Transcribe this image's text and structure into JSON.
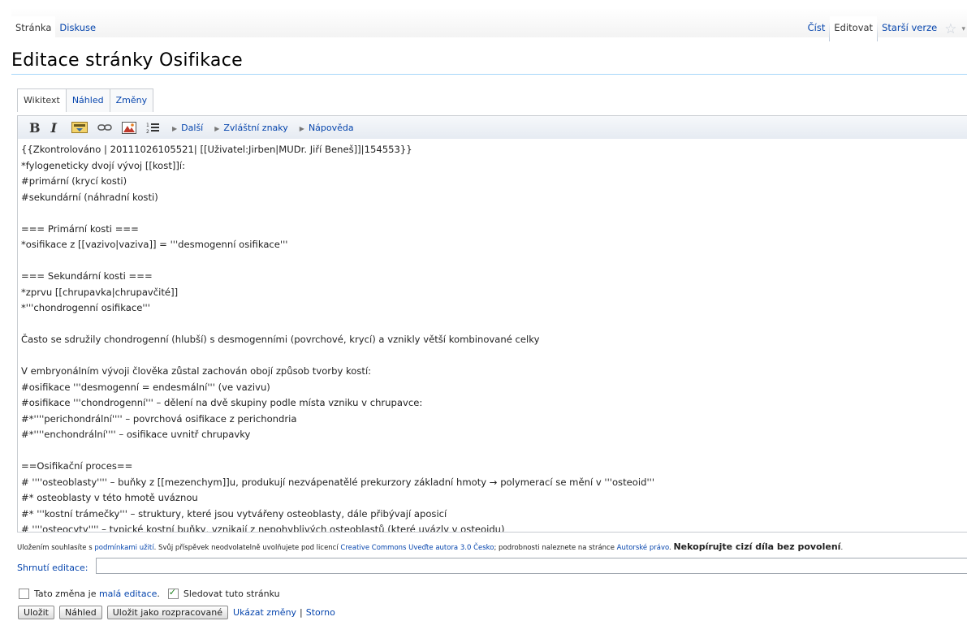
{
  "page_tabs_left": [
    "Stránka",
    "Diskuse"
  ],
  "page_tabs_right": [
    "Číst",
    "Editovat",
    "Starší verze"
  ],
  "title": "Editace stránky Osifikace",
  "editor_tabs": [
    "Wikitext",
    "Náhled",
    "Změny"
  ],
  "toolbar": {
    "bold": "B",
    "italic": "I",
    "more": "Další",
    "special_chars": "Zvláštní znaky",
    "help": "Nápověda"
  },
  "wikitext": "{{Zkontrolováno | 20111026105521| [[Uživatel:Jirben|MUDr. Jiří Beneš]]|154553}}\n*fylogeneticky dvojí vývoj [[kost]]í:\n#primární (krycí kosti)\n#sekundární (náhradní kosti)\n\n=== Primární kosti ===\n*osifikace z [[vazivo|vaziva]] = '''desmogenní osifikace'''\n\n=== Sekundární kosti ===\n*zprvu [[chrupavka|chrupavčité]]\n*'''chondrogenní osifikace'''\n\nČasto se sdružily chondrogenní (hlubší) s desmogenními (povrchové, krycí) a vznikly větší kombinované celky\n\nV embryonálním vývoji člověka zůstal zachován obojí způsob tvorby kostí:\n#osifikace '''desmogenní = endesmální''' (ve vazivu)\n#osifikace '''chondrogenní''' – dělení na dvě skupiny podle místa vzniku v chrupavce:\n#*''''perichondrální'''' – povrchová osifikace z perichondria\n#*''''enchondrální'''' – osifikace uvnitř chrupavky\n\n==Osifikační proces==\n# ''''osteoblasty'''' – buňky z [[mezenchym]]u, produkují nezvápenatělé prekurzory základní hmoty → polymerací se mění v '''osteoid'''\n#* osteoblasty v této hmotě uváznou\n#* '''kostní trámečky''' – struktury, které jsou vytvářeny osteoblasty, dále přibývají aposicí\n# ''''osteocyty'''' – typické kostní buňky, vznikají z nepohyblivých osteoblastů (které uvázly v osteoidu)",
  "license": {
    "t1": "Uložením souhlasíte s ",
    "l1": "podmínkami užití",
    "t2": ". Svůj příspěvek neodvolatelně uvolňujete pod licencí ",
    "l2": "Creative Commons Uveďte autora 3.0 Česko",
    "t3": "; podrobnosti naleznete na stránce ",
    "l3": "Autorské právo",
    "t4": ". ",
    "bold": "Nekopírujte cizí díla bez povolení",
    "t5": "."
  },
  "summary_label": "Shrnutí editace:",
  "summary_value": "",
  "options": {
    "minor_prefix": "Tato změna je ",
    "minor_link": "malá editace",
    "minor_suffix": ".",
    "minor_checked": false,
    "watch_label": "Sledovat tuto stránku",
    "watch_checked": true
  },
  "buttons": {
    "save": "Uložit",
    "preview": "Náhled",
    "save_draft": "Uložit jako rozpracované",
    "show_changes": "Ukázat změny",
    "separator": "|",
    "cancel": "Storno"
  },
  "colors": {
    "link": "#0645ad",
    "title_rule": "#a7d7f9"
  }
}
